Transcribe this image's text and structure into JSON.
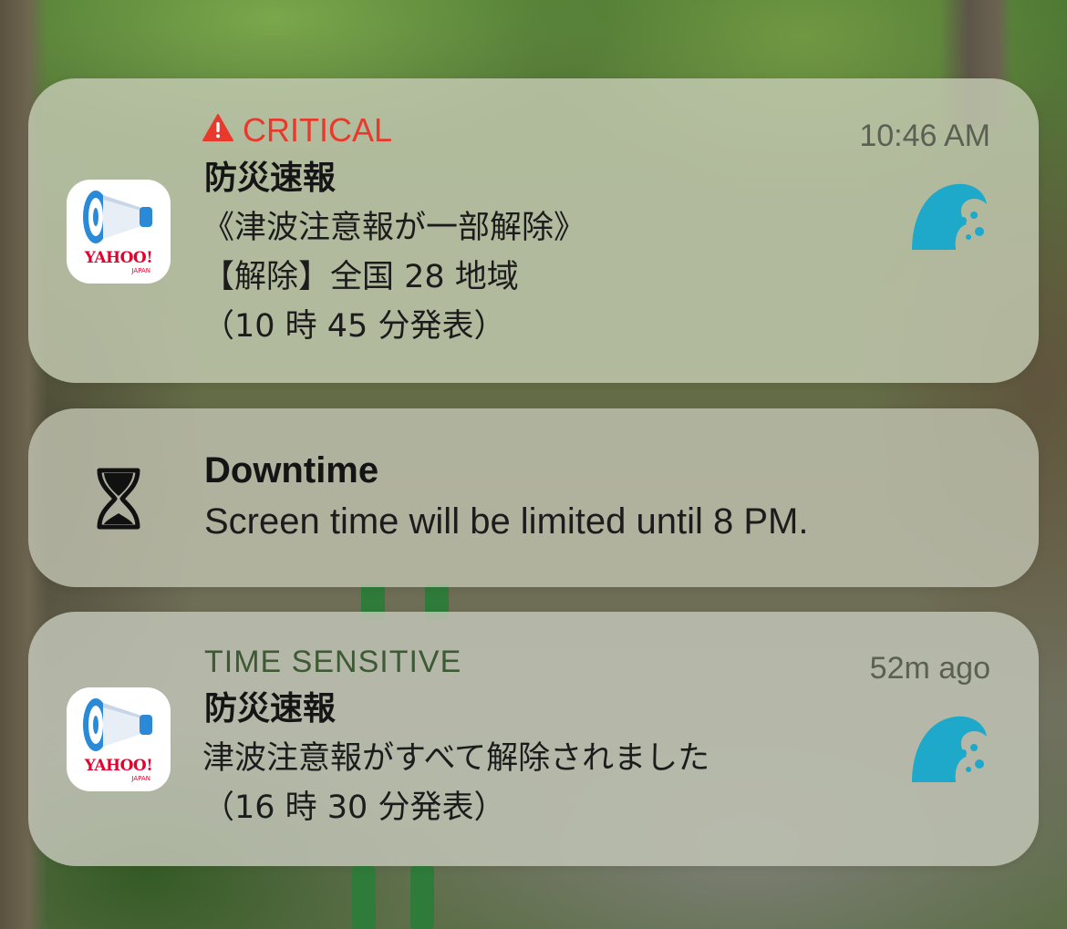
{
  "notifications": [
    {
      "badge_label": "CRITICAL",
      "badge_color": "#e8392c",
      "badge_icon": "warning-triangle-icon",
      "time": "10:46 AM",
      "app_icon": "yahoo-megaphone-icon",
      "app_icon_wordmark": "YAHOO!",
      "app_icon_wordmark_sub": "JAPAN",
      "title": "防災速報",
      "lines": [
        "《津波注意報が一部解除》",
        "【解除】全国 28 地域",
        "（10 時 45 分発表）"
      ],
      "thumbnail_icon": "tsunami-wave-icon"
    },
    {
      "icon": "hourglass-icon",
      "title": "Downtime",
      "body": "Screen time will be limited until 8 PM."
    },
    {
      "badge_label": "TIME SENSITIVE",
      "badge_color": "#3d5a34",
      "time": "52m ago",
      "app_icon": "yahoo-megaphone-icon",
      "app_icon_wordmark": "YAHOO!",
      "app_icon_wordmark_sub": "JAPAN",
      "title": "防災速報",
      "lines": [
        "津波注意報がすべて解除されました",
        "（16 時 30 分発表）"
      ],
      "thumbnail_icon": "tsunami-wave-icon"
    }
  ]
}
